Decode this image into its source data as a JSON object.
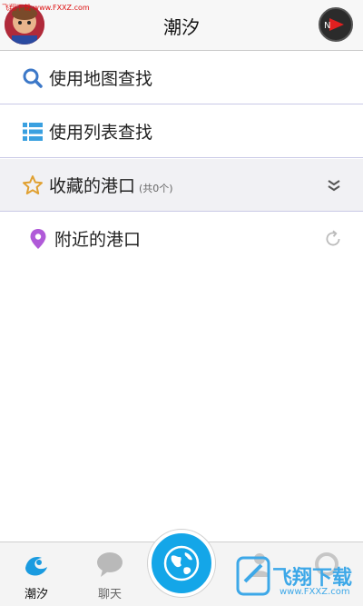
{
  "header": {
    "title": "潮汐",
    "watermark": "飞翔下载 www.FXXZ.com"
  },
  "menu": {
    "map_search": "使用地图查找",
    "list_search": "使用列表查找",
    "favorites": "收藏的港口",
    "favorites_count": "(共0个)",
    "nearby": "附近的港口"
  },
  "tabs": {
    "tide": "潮汐",
    "chat": "聊天"
  },
  "watermark_bottom": {
    "text": "飞翔下载",
    "url": "www.FXXZ.com"
  },
  "colors": {
    "accent_blue": "#14a6e8",
    "favorite_star": "#e0a030",
    "location_pin": "#b05ad8",
    "search_icon": "#3c78c8"
  }
}
